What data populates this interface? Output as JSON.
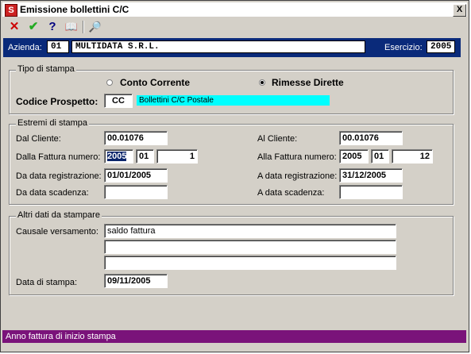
{
  "window": {
    "title": "Emissione bollettini C/C",
    "close_label": "X"
  },
  "toolbar": {
    "icons": {
      "cancel": "✕",
      "confirm": "✔",
      "help": "?",
      "book": "📖",
      "search": "🔎"
    }
  },
  "header": {
    "azienda_label": "Azienda:",
    "azienda_code": "01",
    "azienda_name": "MULTIDATA S.R.L.",
    "esercizio_label": "Esercizio:",
    "esercizio_value": "2005"
  },
  "tipo_stampa": {
    "title": "Tipo di stampa",
    "option1": "Conto Corrente",
    "option2": "Rimesse Dirette",
    "selected": "Rimesse Dirette",
    "codice_label": "Codice Prospetto:",
    "codice_value": "CC",
    "codice_desc": "Bollettini C/C Postale"
  },
  "estremi": {
    "title": "Estremi di stampa",
    "dal_cliente_label": "Dal Cliente:",
    "dal_cliente": "00.01076",
    "al_cliente_label": "Al Cliente:",
    "al_cliente": "00.01076",
    "dalla_fattura_label": "Dalla Fattura numero:",
    "dalla_fattura_anno": "2005",
    "dalla_fattura_sez": "01",
    "dalla_fattura_num": "1",
    "alla_fattura_label": "Alla Fattura numero:",
    "alla_fattura_anno": "2005",
    "alla_fattura_sez": "01",
    "alla_fattura_num": "12",
    "da_data_reg_label": "Da data registrazione:",
    "da_data_reg": "01/01/2005",
    "a_data_reg_label": "A data registrazione:",
    "a_data_reg": "31/12/2005",
    "da_data_scad_label": "Da data scadenza:",
    "da_data_scad": "",
    "a_data_scad_label": "A data scadenza:",
    "a_data_scad": ""
  },
  "altri": {
    "title": "Altri dati da stampare",
    "causale_label": "Causale versamento:",
    "causale1": "saldo fattura",
    "causale2": "",
    "causale3": "",
    "data_stampa_label": "Data di stampa:",
    "data_stampa": "09/11/2005"
  },
  "status": {
    "text": "Anno fattura di inizio stampa"
  },
  "colors": {
    "header_bg": "#0a2a7a",
    "status_bg": "#7a137a",
    "desc_bg": "#00ffff"
  }
}
